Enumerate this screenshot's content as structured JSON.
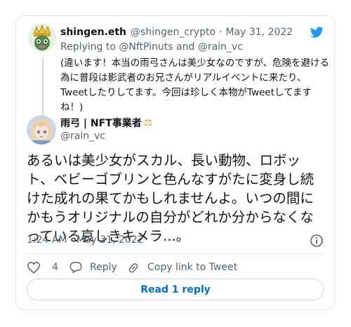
{
  "quoted_tweet": {
    "display_name": "shingen.eth",
    "handle": "@shingen_crypto",
    "separator": "·",
    "date": "May 31, 2022",
    "replying_to": "Replying to @NftPinuts and @rain_vc",
    "text": "(違います！本当の雨弓さんは美少女なのですが、危険を避ける為に普段は影武者のお兄さんがリアルイベントに来たり、Tweetしたりしてます。今回は珍しく本物がTweetしてますね！)"
  },
  "main_tweet": {
    "display_name": "雨弓 | NFT事業者",
    "name_badge": "⚖",
    "handle": "@rain_vc",
    "text": "あるいは美少女がスカル、長い動物、ロボット、ベビーゴブリンと色んなすがたに変身し続けた成れの果てかもしれませんよ。いつの間にかもうオリジナルの自分がどれか分からなくなっている哀しきキメラ...。",
    "timestamp": "1:24 AM · May 31, 2022"
  },
  "actions": {
    "like_count": "4",
    "reply_label": "Reply",
    "copy_link_label": "Copy link to Tweet"
  },
  "read_replies_label": "Read 1 reply",
  "icons": {
    "brand": "twitter-bird-icon",
    "info": "info-icon",
    "like": "heart-icon",
    "reply": "speech-bubble-icon",
    "copy_link": "link-icon"
  },
  "colors": {
    "twitter_blue": "#1d9bf0",
    "link_blue": "#006fd6",
    "text_secondary": "#536471",
    "border": "#e1e8ed"
  }
}
